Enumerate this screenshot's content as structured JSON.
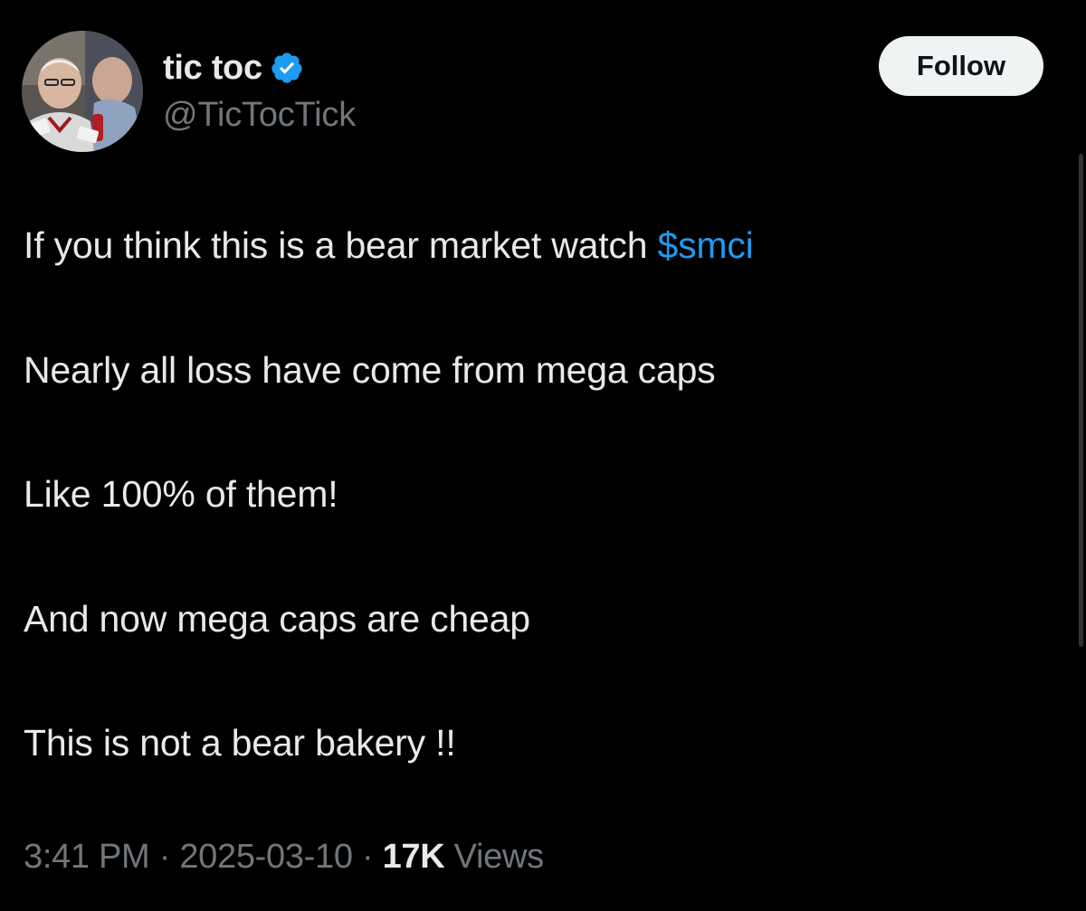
{
  "author": {
    "display_name": "tic toc",
    "handle": "@TicTocTick",
    "verified_icon": "verified-badge",
    "verified_color": "#1d9bf0"
  },
  "follow_button": {
    "label": "Follow"
  },
  "tweet": {
    "line1_text": "If you think this is a bear market watch ",
    "cashtag": "$smci",
    "line2": "Nearly all loss have come from mega caps",
    "line3": "Like 100% of them!",
    "line4": "And now mega caps are cheap",
    "line5": "This is not a bear bakery !!"
  },
  "meta": {
    "time": "3:41 PM",
    "separator": "·",
    "date": "2025-03-10",
    "views_count": "17K",
    "views_label": "Views"
  },
  "colors": {
    "background": "#000000",
    "primary_text": "#e7e9ea",
    "secondary_text": "#71767b",
    "accent": "#1d9bf0",
    "button_bg": "#eff3f4"
  }
}
